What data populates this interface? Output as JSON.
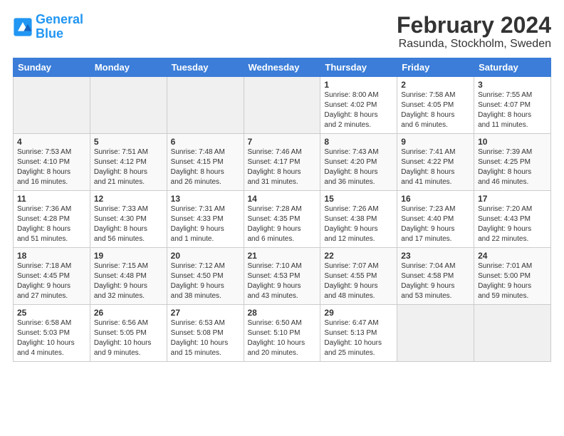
{
  "logo": {
    "line1": "General",
    "line2": "Blue"
  },
  "title": "February 2024",
  "location": "Rasunda, Stockholm, Sweden",
  "days_of_week": [
    "Sunday",
    "Monday",
    "Tuesday",
    "Wednesday",
    "Thursday",
    "Friday",
    "Saturday"
  ],
  "weeks": [
    [
      {
        "day": "",
        "info": ""
      },
      {
        "day": "",
        "info": ""
      },
      {
        "day": "",
        "info": ""
      },
      {
        "day": "",
        "info": ""
      },
      {
        "day": "1",
        "info": "Sunrise: 8:00 AM\nSunset: 4:02 PM\nDaylight: 8 hours\nand 2 minutes."
      },
      {
        "day": "2",
        "info": "Sunrise: 7:58 AM\nSunset: 4:05 PM\nDaylight: 8 hours\nand 6 minutes."
      },
      {
        "day": "3",
        "info": "Sunrise: 7:55 AM\nSunset: 4:07 PM\nDaylight: 8 hours\nand 11 minutes."
      }
    ],
    [
      {
        "day": "4",
        "info": "Sunrise: 7:53 AM\nSunset: 4:10 PM\nDaylight: 8 hours\nand 16 minutes."
      },
      {
        "day": "5",
        "info": "Sunrise: 7:51 AM\nSunset: 4:12 PM\nDaylight: 8 hours\nand 21 minutes."
      },
      {
        "day": "6",
        "info": "Sunrise: 7:48 AM\nSunset: 4:15 PM\nDaylight: 8 hours\nand 26 minutes."
      },
      {
        "day": "7",
        "info": "Sunrise: 7:46 AM\nSunset: 4:17 PM\nDaylight: 8 hours\nand 31 minutes."
      },
      {
        "day": "8",
        "info": "Sunrise: 7:43 AM\nSunset: 4:20 PM\nDaylight: 8 hours\nand 36 minutes."
      },
      {
        "day": "9",
        "info": "Sunrise: 7:41 AM\nSunset: 4:22 PM\nDaylight: 8 hours\nand 41 minutes."
      },
      {
        "day": "10",
        "info": "Sunrise: 7:39 AM\nSunset: 4:25 PM\nDaylight: 8 hours\nand 46 minutes."
      }
    ],
    [
      {
        "day": "11",
        "info": "Sunrise: 7:36 AM\nSunset: 4:28 PM\nDaylight: 8 hours\nand 51 minutes."
      },
      {
        "day": "12",
        "info": "Sunrise: 7:33 AM\nSunset: 4:30 PM\nDaylight: 8 hours\nand 56 minutes."
      },
      {
        "day": "13",
        "info": "Sunrise: 7:31 AM\nSunset: 4:33 PM\nDaylight: 9 hours\nand 1 minute."
      },
      {
        "day": "14",
        "info": "Sunrise: 7:28 AM\nSunset: 4:35 PM\nDaylight: 9 hours\nand 6 minutes."
      },
      {
        "day": "15",
        "info": "Sunrise: 7:26 AM\nSunset: 4:38 PM\nDaylight: 9 hours\nand 12 minutes."
      },
      {
        "day": "16",
        "info": "Sunrise: 7:23 AM\nSunset: 4:40 PM\nDaylight: 9 hours\nand 17 minutes."
      },
      {
        "day": "17",
        "info": "Sunrise: 7:20 AM\nSunset: 4:43 PM\nDaylight: 9 hours\nand 22 minutes."
      }
    ],
    [
      {
        "day": "18",
        "info": "Sunrise: 7:18 AM\nSunset: 4:45 PM\nDaylight: 9 hours\nand 27 minutes."
      },
      {
        "day": "19",
        "info": "Sunrise: 7:15 AM\nSunset: 4:48 PM\nDaylight: 9 hours\nand 32 minutes."
      },
      {
        "day": "20",
        "info": "Sunrise: 7:12 AM\nSunset: 4:50 PM\nDaylight: 9 hours\nand 38 minutes."
      },
      {
        "day": "21",
        "info": "Sunrise: 7:10 AM\nSunset: 4:53 PM\nDaylight: 9 hours\nand 43 minutes."
      },
      {
        "day": "22",
        "info": "Sunrise: 7:07 AM\nSunset: 4:55 PM\nDaylight: 9 hours\nand 48 minutes."
      },
      {
        "day": "23",
        "info": "Sunrise: 7:04 AM\nSunset: 4:58 PM\nDaylight: 9 hours\nand 53 minutes."
      },
      {
        "day": "24",
        "info": "Sunrise: 7:01 AM\nSunset: 5:00 PM\nDaylight: 9 hours\nand 59 minutes."
      }
    ],
    [
      {
        "day": "25",
        "info": "Sunrise: 6:58 AM\nSunset: 5:03 PM\nDaylight: 10 hours\nand 4 minutes."
      },
      {
        "day": "26",
        "info": "Sunrise: 6:56 AM\nSunset: 5:05 PM\nDaylight: 10 hours\nand 9 minutes."
      },
      {
        "day": "27",
        "info": "Sunrise: 6:53 AM\nSunset: 5:08 PM\nDaylight: 10 hours\nand 15 minutes."
      },
      {
        "day": "28",
        "info": "Sunrise: 6:50 AM\nSunset: 5:10 PM\nDaylight: 10 hours\nand 20 minutes."
      },
      {
        "day": "29",
        "info": "Sunrise: 6:47 AM\nSunset: 5:13 PM\nDaylight: 10 hours\nand 25 minutes."
      },
      {
        "day": "",
        "info": ""
      },
      {
        "day": "",
        "info": ""
      }
    ]
  ]
}
